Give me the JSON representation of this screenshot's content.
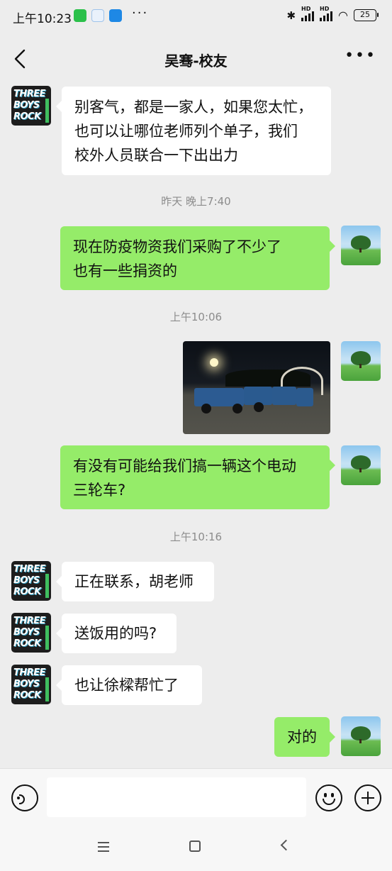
{
  "status_bar": {
    "time": "上午10:23",
    "battery": "25",
    "network_labels": [
      "HD",
      "HD"
    ],
    "app_icon_colors": [
      "#2bc04a",
      "#4a90e2",
      "#1e88e5"
    ]
  },
  "header": {
    "title": "吴骞-校友",
    "back_icon": "chevron-left-icon",
    "more_icon": "more-icon"
  },
  "avatars": {
    "contact": {
      "lines": [
        "THREE",
        "BOYS",
        "ROCK"
      ]
    },
    "self": {
      "description": "landscape-tree"
    }
  },
  "messages": [
    {
      "type": "text",
      "sender": "contact",
      "text": "别客气，都是一家人，如果您太忙，\n也可以让哪位老师列个单子，我们\n校外人员联合一下出出力"
    },
    {
      "type": "time",
      "text": "昨天 晚上7:40"
    },
    {
      "type": "text",
      "sender": "self",
      "text": "现在防疫物资我们采购了不少了\n也有一些捐资的"
    },
    {
      "type": "time",
      "text": "上午10:06"
    },
    {
      "type": "image",
      "sender": "self"
    },
    {
      "type": "text",
      "sender": "self",
      "text": "有没有可能给我们搞一辆这个电动\n三轮车?"
    },
    {
      "type": "time",
      "text": "上午10:16"
    },
    {
      "type": "text",
      "sender": "contact",
      "text": "正在联系，胡老师"
    },
    {
      "type": "text",
      "sender": "contact",
      "text": "送饭用的吗?"
    },
    {
      "type": "text",
      "sender": "contact",
      "text": "也让徐樑帮忙了"
    },
    {
      "type": "text",
      "sender": "self",
      "text": "对的"
    }
  ],
  "input_bar": {
    "voice_icon": "voice-icon",
    "emoji_icon": "emoji-icon",
    "plus_icon": "plus-icon",
    "placeholder": ""
  },
  "colors": {
    "background": "#ededed",
    "outgoing_bubble": "#95ec69",
    "incoming_bubble": "#ffffff"
  }
}
